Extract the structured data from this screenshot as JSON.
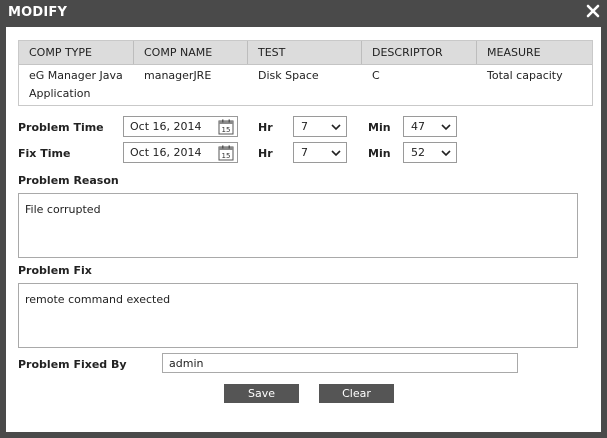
{
  "dialog": {
    "title": "MODIFY"
  },
  "table": {
    "headers": [
      "COMP TYPE",
      "COMP NAME",
      "TEST",
      "DESCRIPTOR",
      "MEASURE"
    ],
    "row": {
      "comp_type_line1": "eG Manager Java",
      "comp_type_line2": "Application",
      "comp_name": "managerJRE",
      "test": "Disk Space",
      "descriptor": "C",
      "measure": "Total capacity"
    }
  },
  "problem_time": {
    "label": "Problem Time",
    "date": "Oct 16, 2014",
    "hr_label": "Hr",
    "hr": "7",
    "min_label": "Min",
    "min": "47"
  },
  "fix_time": {
    "label": "Fix Time",
    "date": "Oct 16, 2014",
    "hr_label": "Hr",
    "hr": "7",
    "min_label": "Min",
    "min": "52"
  },
  "calendar_icon_text": "15",
  "problem_reason": {
    "label": "Problem Reason",
    "value": "File corrupted"
  },
  "problem_fix": {
    "label": "Problem Fix",
    "value": "remote command exected"
  },
  "fixed_by": {
    "label": "Problem Fixed By",
    "value": "admin"
  },
  "buttons": {
    "save": "Save",
    "clear": "Clear"
  },
  "icons": {
    "close": "close-icon",
    "calendar": "calendar-icon",
    "dropdown": "chevron-down-icon"
  },
  "colors": {
    "titlebar": "#4a4a4a",
    "header_row": "#dcdcdc",
    "button": "#555555"
  }
}
